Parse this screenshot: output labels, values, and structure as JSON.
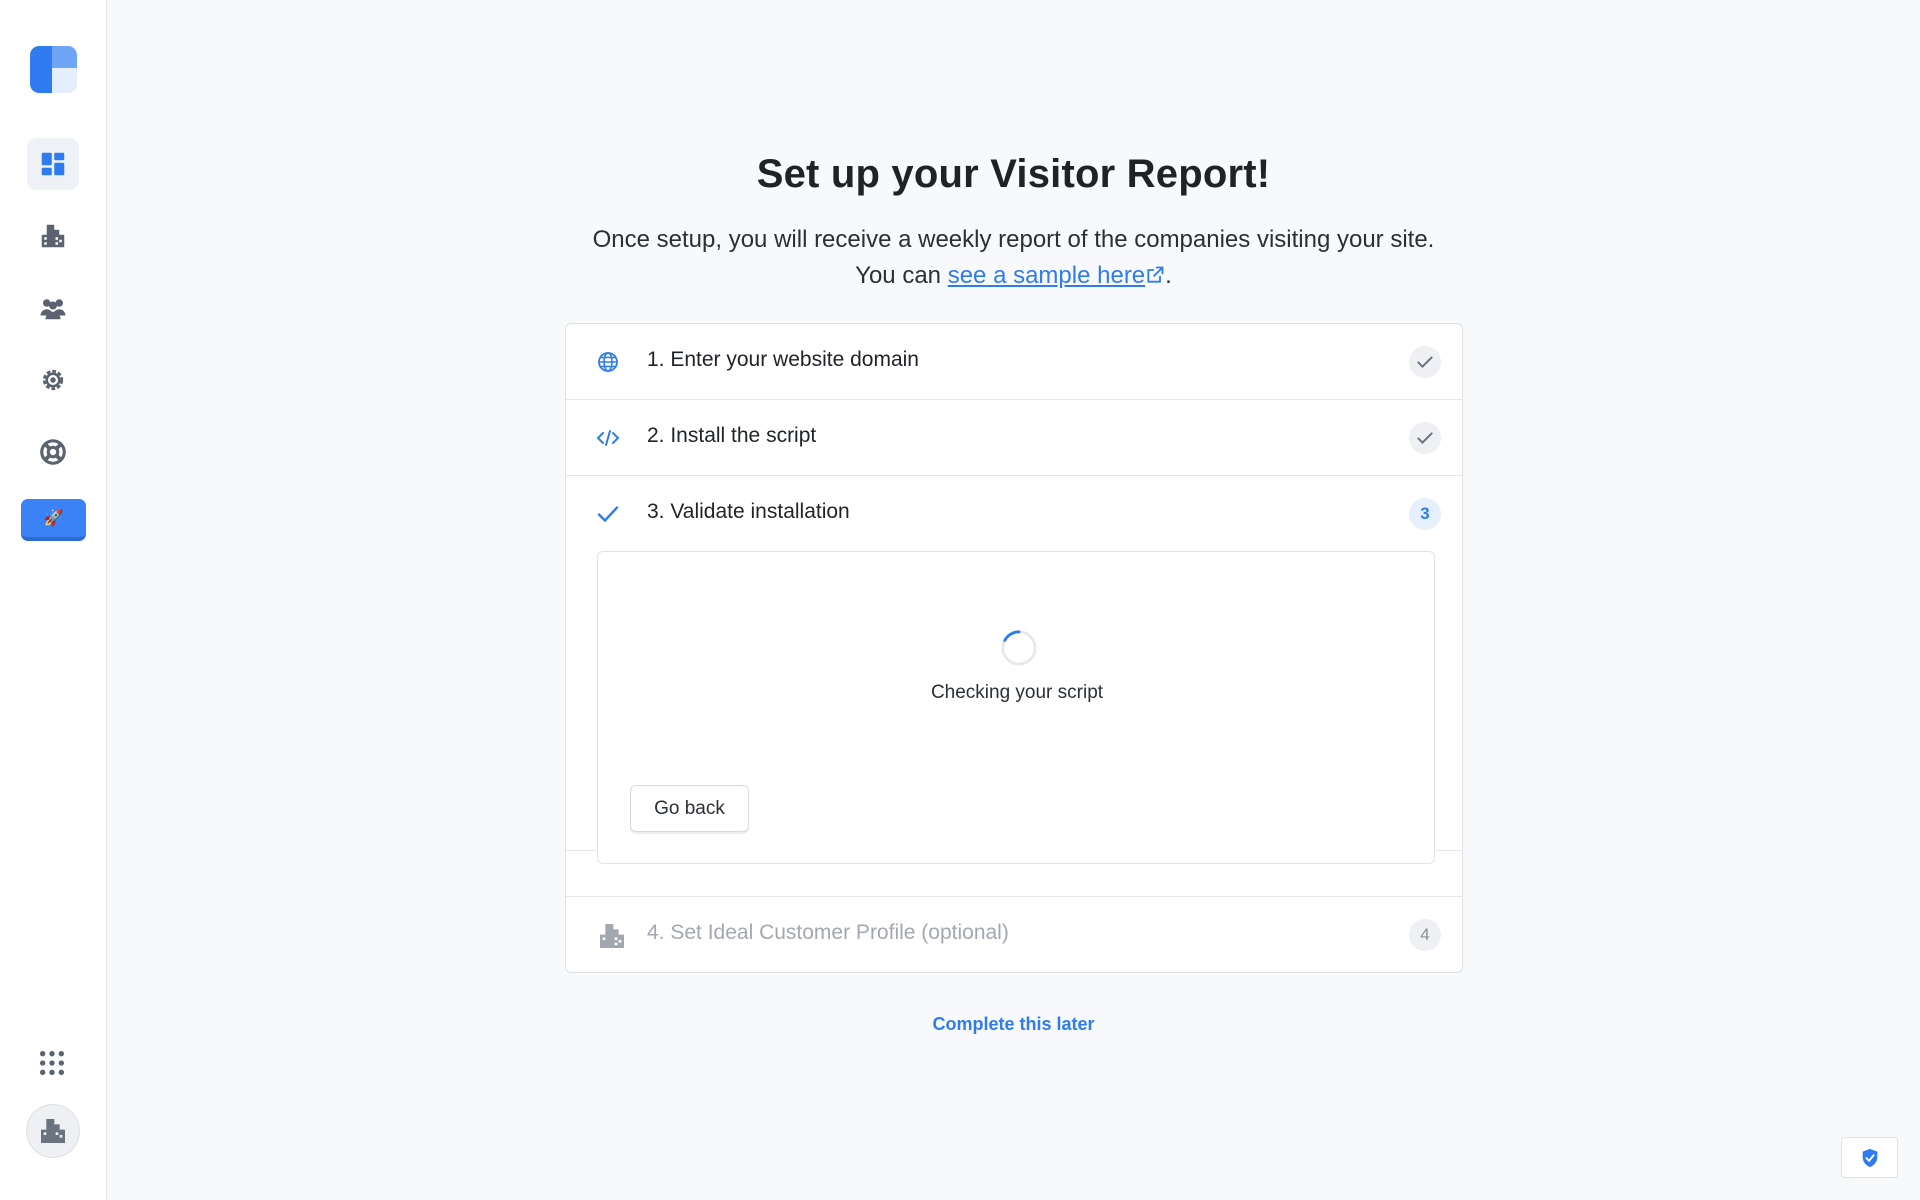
{
  "page": {
    "title": "Set up your Visitor Report!",
    "subtitle_line1": "Once setup, you will receive a weekly report of the companies visiting your site.",
    "subtitle_prefix": "You can",
    "sample_link": "see a sample here",
    "subtitle_suffix": ".",
    "complete_later": "Complete this later"
  },
  "steps": [
    {
      "label": "1. Enter your website domain",
      "icon": "globe-icon",
      "status": "completed"
    },
    {
      "label": "2. Install the script",
      "icon": "code-icon",
      "status": "completed"
    },
    {
      "label": "3. Validate installation",
      "icon": "check-icon",
      "status": "active",
      "badge": "3"
    },
    {
      "label": "4. Set Ideal Customer Profile (optional)",
      "icon": "building-icon",
      "status": "pending",
      "badge": "4"
    }
  ],
  "validation": {
    "status_text": "Checking your script",
    "back_button": "Go back"
  },
  "sidebar": {
    "items": [
      {
        "icon": "dashboard-icon",
        "active": true
      },
      {
        "icon": "building-icon"
      },
      {
        "icon": "people-icon"
      },
      {
        "icon": "gear-icon"
      },
      {
        "icon": "lifebuoy-icon"
      },
      {
        "icon": "rocket-icon",
        "highlighted": true
      }
    ],
    "bottom": [
      "apps-grid-icon",
      "avatar"
    ]
  },
  "colors": {
    "accent": "#2f7cf0",
    "background": "#f8f9fb"
  }
}
